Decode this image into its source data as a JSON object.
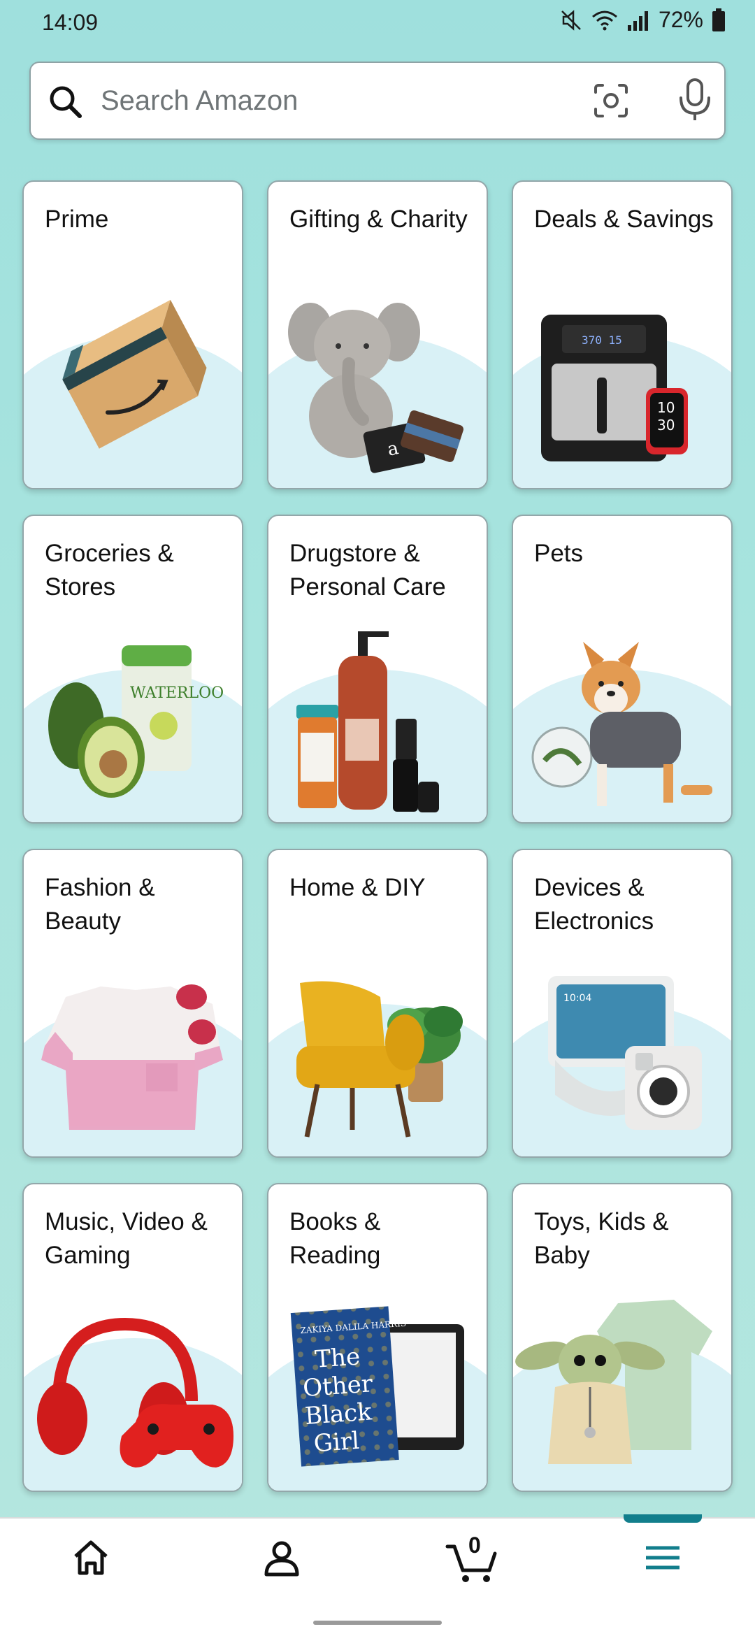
{
  "status_bar": {
    "time": "14:09",
    "battery": "72%",
    "icons": [
      "mute-icon",
      "wifi-icon",
      "signal-icon",
      "battery-icon"
    ]
  },
  "search": {
    "placeholder": "Search Amazon",
    "value": "",
    "icons": [
      "search-icon",
      "camera-icon",
      "mic-icon"
    ]
  },
  "categories": [
    {
      "label": "Prime",
      "icon": "amazon-box"
    },
    {
      "label": "Gifting & Charity",
      "icon": "plush-elephant-gift-cards"
    },
    {
      "label": "Deals & Savings",
      "icon": "air-fryer-smartwatch"
    },
    {
      "label": "Groceries & Stores",
      "icon": "avocado-can"
    },
    {
      "label": "Drugstore & Personal Care",
      "icon": "pharmacy-bottles"
    },
    {
      "label": "Pets",
      "icon": "corgi-fishbowl"
    },
    {
      "label": "Fashion & Beauty",
      "icon": "tshirt-sunglasses"
    },
    {
      "label": "Home & DIY",
      "icon": "armchair-plant"
    },
    {
      "label": "Devices & Electronics",
      "icon": "echo-show-camera"
    },
    {
      "label": "Music, Video & Gaming",
      "icon": "headphones-controller"
    },
    {
      "label": "Books & Reading",
      "icon": "book-kindle"
    },
    {
      "label": "Toys, Kids & Baby",
      "icon": "baby-yoda-onesie"
    }
  ],
  "bottom_nav": {
    "items": [
      "home-icon",
      "account-icon",
      "cart-icon",
      "menu-icon"
    ],
    "cart_count": "0",
    "active": "menu-icon"
  },
  "colors": {
    "background_top": "#9fe0dd",
    "card_arc": "#d9f1f6",
    "accent": "#127e8c"
  }
}
